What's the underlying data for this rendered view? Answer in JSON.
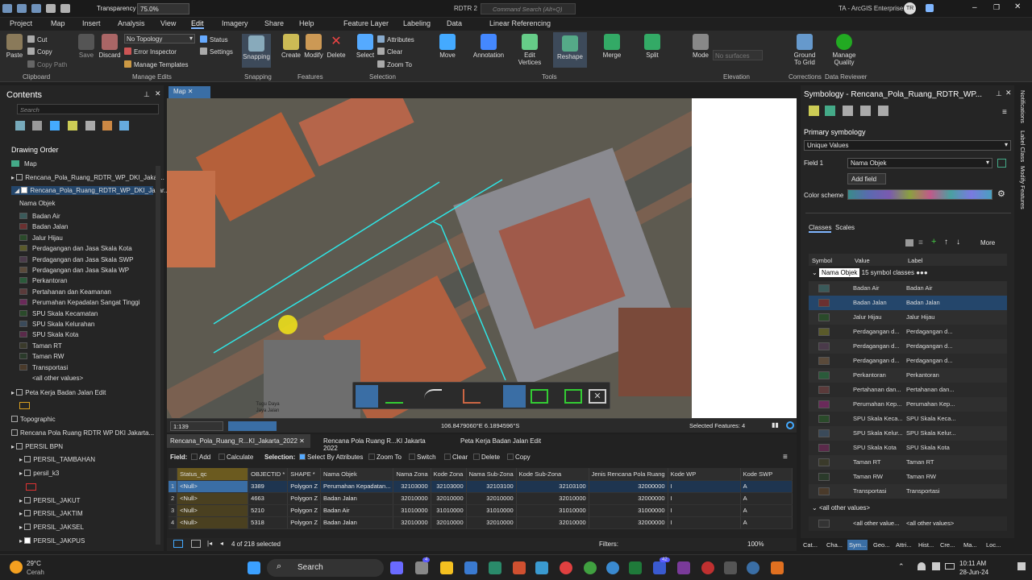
{
  "titlebar": {
    "transparency_label": "Transparency",
    "transparency_value": "75.0%",
    "project": "RDTR 2",
    "search_placeholder": "Command Search (Alt+Q)",
    "portal": "TA - ArcGIS Enterprise",
    "user_initials": "TR"
  },
  "menu": {
    "tabs": [
      "Project",
      "Map",
      "Insert",
      "Analysis",
      "View",
      "Edit",
      "Imagery",
      "Share",
      "Help",
      "Feature Layer",
      "Labeling",
      "Data",
      "Linear Referencing"
    ],
    "active": "Edit"
  },
  "ribbon": {
    "clipboard": {
      "paste": "Paste",
      "cut": "Cut",
      "copy": "Copy",
      "copy_path": "Copy Path",
      "label": "Clipboard"
    },
    "manage": {
      "save": "Save",
      "discard": "Discard",
      "topology": "No Topology",
      "status": "Status",
      "error_inspector": "Error Inspector",
      "settings": "Settings",
      "manage_templates": "Manage Templates",
      "label": "Manage Edits"
    },
    "snapping": {
      "snapping": "Snapping",
      "label": "Snapping"
    },
    "features": {
      "create": "Create",
      "modify": "Modify",
      "delete": "Delete",
      "label": "Features"
    },
    "selection": {
      "select": "Select",
      "attributes": "Attributes",
      "clear": "Clear",
      "zoom_to": "Zoom To",
      "label": "Selection"
    },
    "tools": {
      "move": "Move",
      "annotation": "Annotation",
      "edit_vertices": "Edit Vertices",
      "reshape": "Reshape",
      "merge": "Merge",
      "split": "Split",
      "label": "Tools"
    },
    "elevation": {
      "mode": "Mode",
      "no_surfaces": "No surfaces",
      "label": "Elevation"
    },
    "corrections": {
      "ground": "Ground To Grid",
      "label": "Corrections"
    },
    "reviewer": {
      "manage_quality": "Manage Quality",
      "label": "Data Reviewer"
    }
  },
  "contents": {
    "title": "Contents",
    "search_placeholder": "Search",
    "drawing_order": "Drawing Order",
    "map": "Map",
    "layers": [
      "Rencana_Pola_Ruang_RDTR_WP_DKI_Jakar...",
      "Rencana_Pola_Ruang_RDTR_WP_DKI_Jakar..."
    ],
    "field_heading": "Nama Objek",
    "classes": [
      "Badan Air",
      "Badan Jalan",
      "Jalur Hijau",
      "Perdagangan dan Jasa Skala Kota",
      "Perdagangan dan Jasa Skala SWP",
      "Perdagangan dan Jasa Skala WP",
      "Perkantoran",
      "Pertahanan dan Keamanan",
      "Perumahan Kepadatan Sangat Tinggi",
      "SPU Skala Kecamatan",
      "SPU Skala Kelurahan",
      "SPU Skala Kota",
      "Taman RT",
      "Taman RW",
      "Transportasi",
      "<all other values>"
    ],
    "class_colors": [
      "#3a5a5a",
      "#6b3030",
      "#2a4a2a",
      "#5a5a2a",
      "#4a3a4a",
      "#5a4a3a",
      "#2a5a3a",
      "#5a3a3a",
      "#6a2a5a",
      "#2a4a2a",
      "#3a4a5a",
      "#5a2a4a",
      "#3a3a2a",
      "#2a3a2a",
      "#4a3a2a",
      "#333333"
    ],
    "other_layers": [
      "Peta Kerja Badan Jalan Edit",
      "Topographic",
      "Rencana Pola Ruang RDTR WP DKI Jakarta...",
      "PERSIL BPN",
      "PERSIL_TAMBAHAN",
      "persil_k3",
      "PERSIL_JAKUT",
      "PERSIL_JAKTIM",
      "PERSIL_JAKSEL",
      "PERSIL_JAKPUS"
    ]
  },
  "map": {
    "tab": "Map",
    "scale": "1:139",
    "coords": "106.8479060°E 6.1894596°S",
    "selected": "Selected Features: 4",
    "label1": "Tugu Daya",
    "label2": "Jaya Jalan"
  },
  "attribute": {
    "tabs": [
      "Rencana_Pola_Ruang_R...KI_Jakarta_2022",
      "Rencana Pola Ruang R...KI Jakarta 2022",
      "Peta Kerja Badan Jalan Edit"
    ],
    "toolbar": {
      "field": "Field:",
      "add": "Add",
      "calculate": "Calculate",
      "selection": "Selection:",
      "select_by_attr": "Select By Attributes",
      "zoom_to": "Zoom To",
      "switch": "Switch",
      "clear": "Clear",
      "delete": "Delete",
      "copy": "Copy"
    },
    "columns": [
      "Status_qc",
      "OBJECTID *",
      "SHAPE *",
      "Nama Objek",
      "Nama Zona",
      "Kode Zona",
      "Nama Sub-Zona",
      "Kode Sub-Zona",
      "Jenis Rencana Pola Ruang",
      "Kode WP",
      "Kode SWP"
    ],
    "rows": [
      [
        "1",
        "<Null>",
        "3389",
        "Polygon Z",
        "Perumahan Kepadatan...",
        "32103000",
        "32103000",
        "32103100",
        "32103100",
        "32000000",
        "I",
        "A"
      ],
      [
        "2",
        "<Null>",
        "4663",
        "Polygon Z",
        "Badan Jalan",
        "32010000",
        "32010000",
        "32010000",
        "32010000",
        "32000000",
        "I",
        "A"
      ],
      [
        "3",
        "<Null>",
        "5210",
        "Polygon Z",
        "Badan Air",
        "31010000",
        "31010000",
        "31010000",
        "31010000",
        "31000000",
        "I",
        "A"
      ],
      [
        "4",
        "<Null>",
        "5318",
        "Polygon Z",
        "Badan Jalan",
        "32010000",
        "32010000",
        "32010000",
        "32010000",
        "32000000",
        "I",
        "A"
      ]
    ],
    "status": "4 of 218 selected",
    "filters": "Filters:",
    "zoom": "100%"
  },
  "symbology": {
    "title": "Symbology - Rencana_Pola_Ruang_RDTR_WP...",
    "primary": "Primary symbology",
    "method": "Unique Values",
    "field1_label": "Field 1",
    "field1": "Nama Objek",
    "add_field": "Add field",
    "color_scheme": "Color scheme",
    "tabs": [
      "Classes",
      "Scales"
    ],
    "more": "More",
    "headers": [
      "Symbol",
      "Value",
      "Label"
    ],
    "group": "Nama Objek",
    "group_count": "15 symbol classes",
    "rows": [
      [
        "Badan Air",
        "Badan Air"
      ],
      [
        "Badan Jalan",
        "Badan Jalan"
      ],
      [
        "Jalur Hijau",
        "Jalur Hijau"
      ],
      [
        "Perdagangan d...",
        "Perdagangan d..."
      ],
      [
        "Perdagangan d...",
        "Perdagangan d..."
      ],
      [
        "Perdagangan d...",
        "Perdagangan d..."
      ],
      [
        "Perkantoran",
        "Perkantoran"
      ],
      [
        "Pertahanan dan...",
        "Pertahanan dan..."
      ],
      [
        "Perumahan Kep...",
        "Perumahan Kep..."
      ],
      [
        "SPU Skala Keca...",
        "SPU Skala Keca..."
      ],
      [
        "SPU Skala Kelur...",
        "SPU Skala Kelur..."
      ],
      [
        "SPU Skala Kota",
        "SPU Skala Kota"
      ],
      [
        "Taman RT",
        "Taman RT"
      ],
      [
        "Taman RW",
        "Taman RW"
      ],
      [
        "Transportasi",
        "Transportasi"
      ]
    ],
    "other_group": "<all other values>",
    "other_value": "<all other value...",
    "other_label": "<all other values>",
    "bottom_tabs": [
      "Cat...",
      "Cha...",
      "Sym...",
      "Geo...",
      "Attri...",
      "Hist...",
      "Cre...",
      "Ma...",
      "Loc..."
    ],
    "side_tabs": [
      "Notifications",
      "Label Class",
      "Modify Features"
    ]
  },
  "taskbar": {
    "temp": "29°C",
    "weather": "Cerah",
    "search": "Search",
    "time": "10:11 AM",
    "date": "28-Jun-24",
    "badge1": "4",
    "badge2": "42"
  }
}
